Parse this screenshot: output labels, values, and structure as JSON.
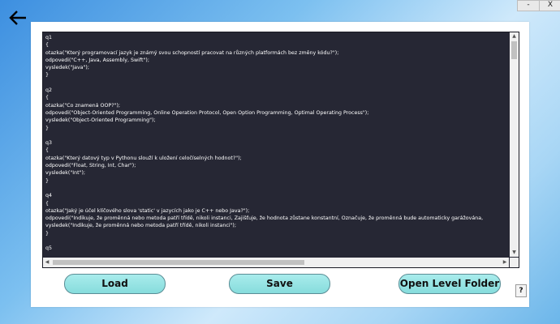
{
  "window": {
    "minimize_label": "-",
    "close_label": "X"
  },
  "nav": {
    "back_icon": "left-arrow-icon"
  },
  "editor": {
    "lines": [
      "q1",
      "{",
      "otazka(\"Který programovací jazyk je známý svou schopností pracovat na různých platformách bez změny kódu?\");",
      "odpovedi(\"C++, Java, Assembly, Swift\");",
      "vysledek(\"Java\");",
      "}",
      "",
      "q2",
      "{",
      "otazka(\"Co znamená OOP?\");",
      "odpovedi(\"Object-Oriented Programming, Online Operation Protocol, Open Option Programming, Optimal Operating Process\");",
      "vysledek(\"Object-Oriented Programming\");",
      "}",
      "",
      "q3",
      "{",
      "otazka(\"Který datový typ v Pythonu slouží k uložení celočíselných hodnot?\");",
      "odpovedi(\"Float, String, Int, Char\");",
      "vysledek(\"Int\");",
      "}",
      "",
      "q4",
      "{",
      "otazka(\"Jaký je účel klíčového slova 'static' v jazycích jako je C++ nebo Java?\");",
      "odpovedi(\"Indikuje, že proměnná nebo metoda patří třídě, nikoli instanci, Zajišťuje, že hodnota zůstane konstantní, Označuje, že proměnná bude automaticky garážována,",
      "vysledek(\"Indikuje, že proměnná nebo metoda patří třídě, nikoli instanci\");",
      "}",
      "",
      "q5"
    ]
  },
  "buttons": {
    "load": "Load",
    "save": "Save",
    "open_folder": "Open Level Folder",
    "help": "?"
  }
}
